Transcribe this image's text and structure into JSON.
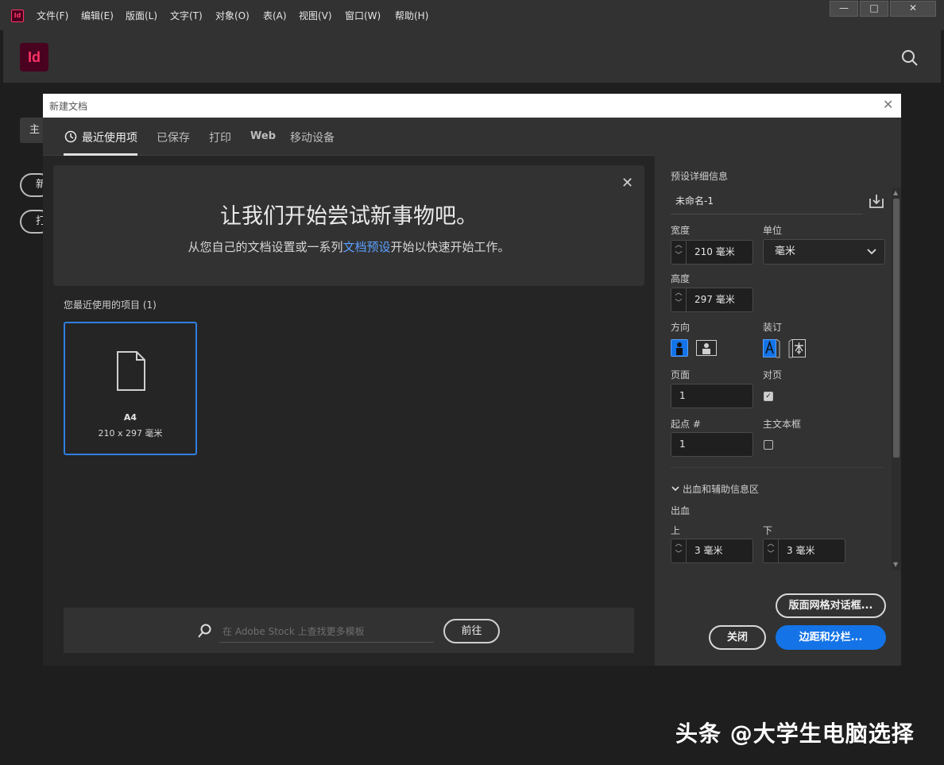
{
  "app": {
    "badge": "Id",
    "logo": "Id",
    "menu": [
      "文件(F)",
      "编辑(E)",
      "版面(L)",
      "文字(T)",
      "对象(O)",
      "表(A)",
      "视图(V)",
      "窗口(W)",
      "帮助(H)"
    ],
    "window_buttons": [
      "—",
      "□",
      "✕"
    ]
  },
  "home_bg": {
    "tab": "主",
    "btn1": "新",
    "btn2": "打"
  },
  "dialog": {
    "title": "新建文档",
    "tabs": [
      "最近使用项",
      "已保存",
      "打印",
      "Web",
      "移动设备"
    ],
    "banner": {
      "title": "让我们开始尝试新事物吧。",
      "sub_before": "从您自己的文档设置或一系列",
      "sub_link": "文档预设",
      "sub_after": "开始以快速开始工作。"
    },
    "recent_label": "您最近使用的项目 (1)",
    "recent_items": [
      {
        "name": "A4",
        "size": "210 x 297 毫米"
      }
    ],
    "stock": {
      "placeholder": "在 Adobe Stock 上查找更多模板",
      "go": "前往"
    },
    "preset": {
      "header": "预设详细信息",
      "name": "未命名-1",
      "width_label": "宽度",
      "width": "210 毫米",
      "unit_label": "单位",
      "unit": "毫米",
      "height_label": "高度",
      "height": "297 毫米",
      "orientation_label": "方向",
      "binding_label": "装订",
      "pages_label": "页面",
      "pages": "1",
      "facing_label": "对页",
      "facing_checked": true,
      "start_label": "起点 #",
      "start": "1",
      "primary_frame_label": "主文本框",
      "primary_frame_checked": false,
      "bleed_section": "出血和辅助信息区",
      "bleed_label": "出血",
      "top_label": "上",
      "top": "3 毫米",
      "bottom_label": "下",
      "bottom": "3 毫米"
    },
    "buttons": {
      "layout_grid": "版面网格对话框...",
      "close": "关闭",
      "margins": "边距和分栏..."
    }
  },
  "watermark": "头条 @大学生电脑选择",
  "colors": {
    "accent": "#1473e6",
    "link": "#5aa0ff",
    "brand": "#ff3366"
  }
}
